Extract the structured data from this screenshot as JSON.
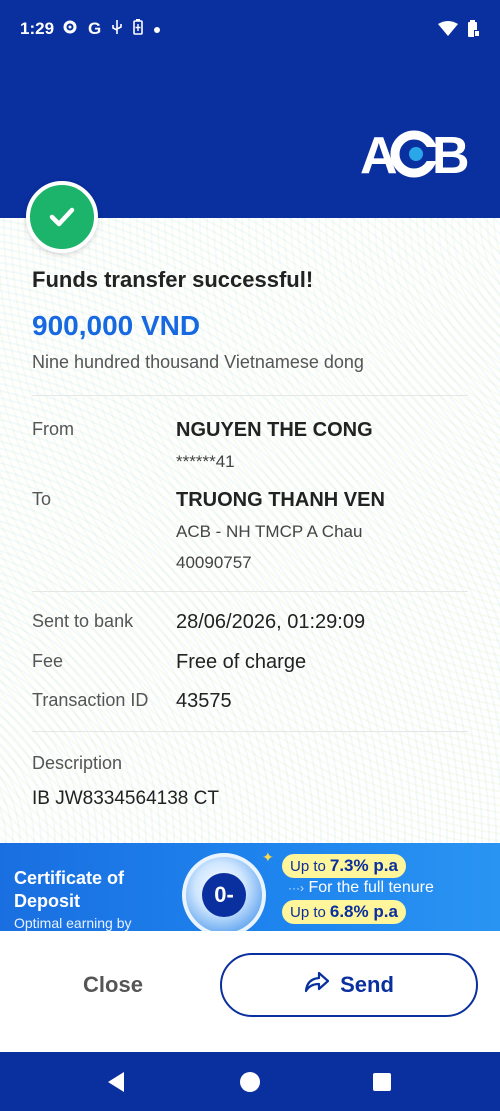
{
  "status_bar": {
    "time": "1:29",
    "left_icons": [
      "gear-icon",
      "google-icon",
      "usb-icon",
      "battery-saver-icon",
      "dot-icon"
    ],
    "right_icons": [
      "wifi-icon",
      "battery-icon"
    ]
  },
  "header": {
    "logo_text": "ACB",
    "bg_color": "#0a2f9e"
  },
  "receipt": {
    "title": "Funds transfer successful!",
    "amount": "900,000 VND",
    "amount_words": "Nine hundred thousand Vietnamese dong",
    "from": {
      "label": "From",
      "name": "NGUYEN THE CONG",
      "account": "******41"
    },
    "to": {
      "label": "To",
      "name": "TRUONG THANH VEN",
      "bank": "ACB - NH TMCP A Chau",
      "account": "40090757"
    },
    "sent_to_bank": {
      "label": "Sent to bank",
      "value": "28/06/2026, 01:29:09"
    },
    "fee": {
      "label": "Fee",
      "value": "Free of charge"
    },
    "transaction_id": {
      "label": "Transaction ID",
      "value": "43575"
    },
    "description": {
      "label": "Description",
      "value": "IB JW8334564138 CT"
    }
  },
  "promo": {
    "title_line1": "Certificate of",
    "title_line2": "Deposit",
    "subtitle": "Optimal earning by",
    "rate1_prefix": "Up to",
    "rate1_value": "7.3% p.a",
    "rate1_note": "For the full tenure",
    "rate2_prefix": "Up to",
    "rate2_value": "6.8% p.a",
    "coin_text": "0-"
  },
  "actions": {
    "close_label": "Close",
    "send_label": "Send"
  },
  "nav": [
    "back-icon",
    "home-icon",
    "recents-icon"
  ]
}
